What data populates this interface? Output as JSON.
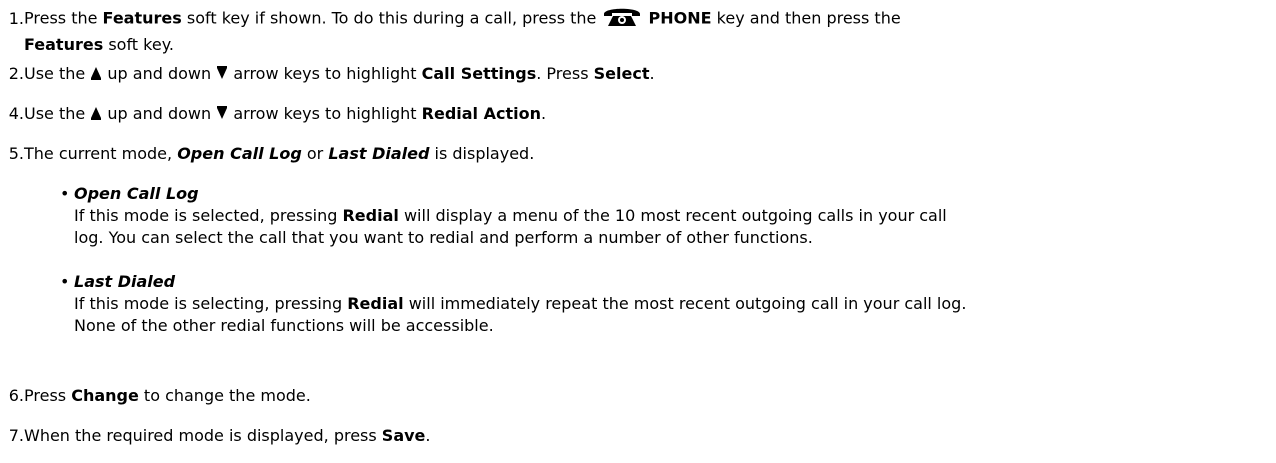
{
  "steps": [
    {
      "num": "1.",
      "t1": "Press the ",
      "b1": "Features",
      "t2": " soft key if shown. To do this during a call, press the ",
      "icon": "phone-icon",
      "b2": "PHONE",
      "t3": " key and then press the",
      "b3": "Features",
      "t4": " soft key."
    },
    {
      "num": "2.",
      "t1": "Use the ",
      "icon_up": "up-arrow-icon",
      "t2": " up and down ",
      "icon_down": "down-arrow-icon",
      "t3": " arrow keys to highlight ",
      "b1": "Call Settings",
      "t4": ". Press ",
      "b2": "Select",
      "t5": "."
    },
    {
      "num": "4.",
      "t1": "Use the ",
      "icon_up": "up-arrow-icon",
      "t2": " up and down ",
      "icon_down": "down-arrow-icon",
      "t3": " arrow keys to highlight ",
      "b1": "Redial Action",
      "t4": "."
    },
    {
      "num": "5.",
      "t1": "The current mode, ",
      "bi1": "Open Call Log",
      "t2": " or ",
      "bi2": "Last Dialed",
      "t3": " is displayed."
    },
    {
      "num": "6.",
      "t1": "Press ",
      "b1": "Change",
      "t2": " to change the mode."
    },
    {
      "num": "7.",
      "t1": "When the required mode is displayed, press ",
      "b1": "Save",
      "t2": "."
    }
  ],
  "bullets": [
    {
      "dot": "•",
      "title": "Open Call Log",
      "t1": "If this mode is selected, pressing ",
      "b1": "Redial",
      "t2": " will display a menu of the 10 most recent outgoing calls in your call",
      "t3": "log. You can select the call that you want to redial and perform a number of other functions."
    },
    {
      "dot": "•",
      "title": "Last Dialed",
      "t1": "If this mode is selecting, pressing ",
      "b1": "Redial",
      "t2": " will immediately repeat the most recent outgoing call in your call log.",
      "t3": "None of the other redial functions will be accessible."
    }
  ]
}
